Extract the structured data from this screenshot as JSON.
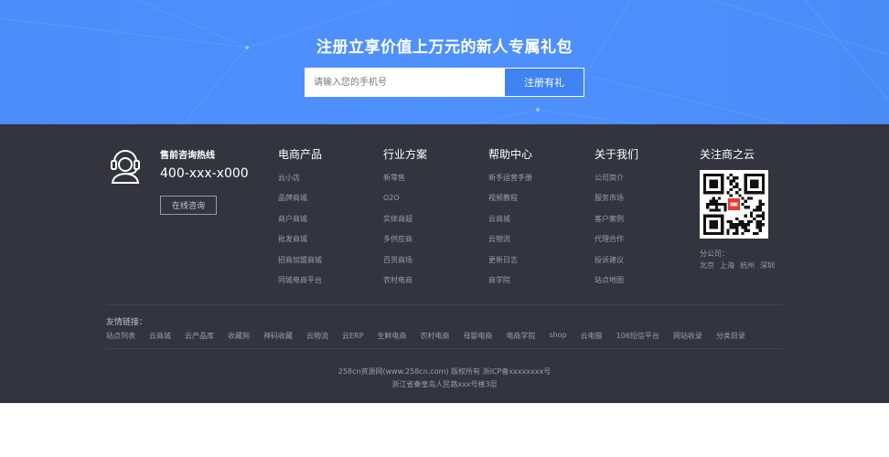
{
  "banner": {
    "title": "注册立享价值上万元的新人专属礼包",
    "phone_placeholder": "请输入您的手机号",
    "register_button": "注册有礼"
  },
  "hotline": {
    "icon": "headset-icon",
    "title": "售前咨询热线",
    "phone": "400-xxx-x000",
    "consult_button": "在线咨询"
  },
  "columns": [
    {
      "title": "电商产品",
      "items": [
        "云小店",
        "品牌商城",
        "商户商城",
        "批发商城",
        "招商加盟商城",
        "同城电商平台"
      ]
    },
    {
      "title": "行业方案",
      "items": [
        "新零售",
        "O2O",
        "实体商超",
        "多供应商",
        "百货商场",
        "农村电商"
      ]
    },
    {
      "title": "帮助中心",
      "items": [
        "新手运营手册",
        "视频教程",
        "云商城",
        "云物流",
        "更新日志",
        "商学院"
      ]
    },
    {
      "title": "关于我们",
      "items": [
        "公司简介",
        "服务市场",
        "客户案例",
        "代理合作",
        "投诉建议",
        "站点地图"
      ]
    }
  ],
  "follow": {
    "title": "关注商之云",
    "offices_label": "分公司：",
    "offices": [
      "北京",
      "上海",
      "杭州",
      "深圳"
    ]
  },
  "friend_links": {
    "label": "友情链接：",
    "items": [
      "站点列表",
      "云商城",
      "云产品库",
      "收藏狗",
      "神码收藏",
      "云物流",
      "云ERP",
      "生鲜电商",
      "农村电商",
      "母婴电商",
      "电商学院",
      "shop",
      "云电脑",
      "106短信平台",
      "网站收录",
      "分类目录"
    ]
  },
  "copyright": {
    "line1": "258cn资源网(www.258cn.com) 版权所有    浙ICP备xxxxxxxx号",
    "line2": "浙江省秦皇岛人民路xxx号楼3层"
  },
  "colors": {
    "banner_blue": "#4a8df8",
    "button_blue": "#3f83f5",
    "footer_bg": "#33343d",
    "qr_accent": "#e83a2e"
  }
}
